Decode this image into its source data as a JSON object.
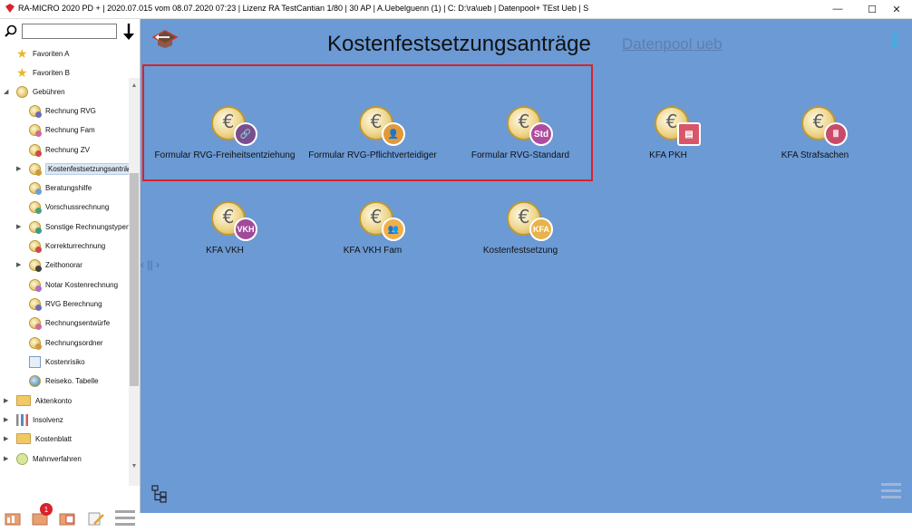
{
  "window": {
    "title": "RA-MICRO 2020 PD + | 2020.07.015 vom 08.07.2020 07:23  | Lizenz RA TestCantian  1/80 | 30 AP | A.Uebelguenn (1) | C: D:\\ra\\ueb | Datenpool+ TEst Ueb | S",
    "minimize": "—",
    "maximize": "☐",
    "close": "✕"
  },
  "search": {
    "value": "",
    "placeholder": ""
  },
  "sidebar": {
    "favorites": [
      {
        "label": "Favoriten A"
      },
      {
        "label": "Favoriten B"
      }
    ],
    "group": {
      "label": "Gebühren"
    },
    "items": [
      {
        "label": "Rechnung RVG",
        "color": "#6b6bb8"
      },
      {
        "label": "Rechnung Fam",
        "color": "#d06a9a"
      },
      {
        "label": "Rechnung ZV",
        "color": "#d04848"
      },
      {
        "label": "Kostenfestsetzungsanträge",
        "color": "#c89a3a"
      },
      {
        "label": "Beratungshilfe",
        "color": "#6aa0d8"
      },
      {
        "label": "Vorschussrechnung",
        "color": "#4aa07a"
      },
      {
        "label": "Sonstige Rechnungstypen",
        "color": "#3a9a8a"
      },
      {
        "label": "Korrekturrechnung",
        "color": "#d04848"
      },
      {
        "label": "Zeithonorar",
        "color": "#404040"
      },
      {
        "label": "Notar Kostenrechnung",
        "color": "#b06ad0"
      },
      {
        "label": "RVG Berechnung",
        "color": "#6b6bb8"
      },
      {
        "label": "Rechnungsentwürfe",
        "color": "#d06a9a"
      },
      {
        "label": "Rechnungsordner",
        "color": "#d09a40"
      },
      {
        "label": "Kostenrisiko",
        "color": "#4a8ad0"
      },
      {
        "label": "Reiseko. Tabelle",
        "color": "#3a7aa0"
      }
    ],
    "groups": [
      {
        "label": "Aktenkonto"
      },
      {
        "label": "Insolvenz"
      },
      {
        "label": "Kostenblatt"
      },
      {
        "label": "Mahnverfahren"
      }
    ],
    "notification_count": "1"
  },
  "main": {
    "title": "Kostenfestsetzungsanträge",
    "datapool_link": "Datenpool ueb",
    "pager": "‹ || ›",
    "tiles": [
      {
        "label": "Formular RVG-Freiheitsentziehung",
        "badge_text": "🔗",
        "badge_color": "#7a4d8f"
      },
      {
        "label": "Formular RVG-Pflichtverteidiger",
        "badge_text": "👤",
        "badge_color": "#e09a3a"
      },
      {
        "label": "Formular RVG-Standard",
        "badge_text": "Std",
        "badge_color": "#b04ca0"
      },
      {
        "label": "KFA PKH",
        "badge_text": "▤",
        "badge_color": "#d9566a"
      },
      {
        "label": "KFA Strafsachen",
        "badge_text": "Ⅲ",
        "badge_color": "#c94b6a"
      },
      {
        "label": "KFA VKH",
        "badge_text": "VKH",
        "badge_color": "#a24a9a"
      },
      {
        "label": "KFA VKH Fam",
        "badge_text": "👥",
        "badge_color": "#f0b048"
      },
      {
        "label": "Kostenfestsetzung",
        "badge_text": "KFA",
        "badge_color": "#e7b34a"
      }
    ]
  }
}
